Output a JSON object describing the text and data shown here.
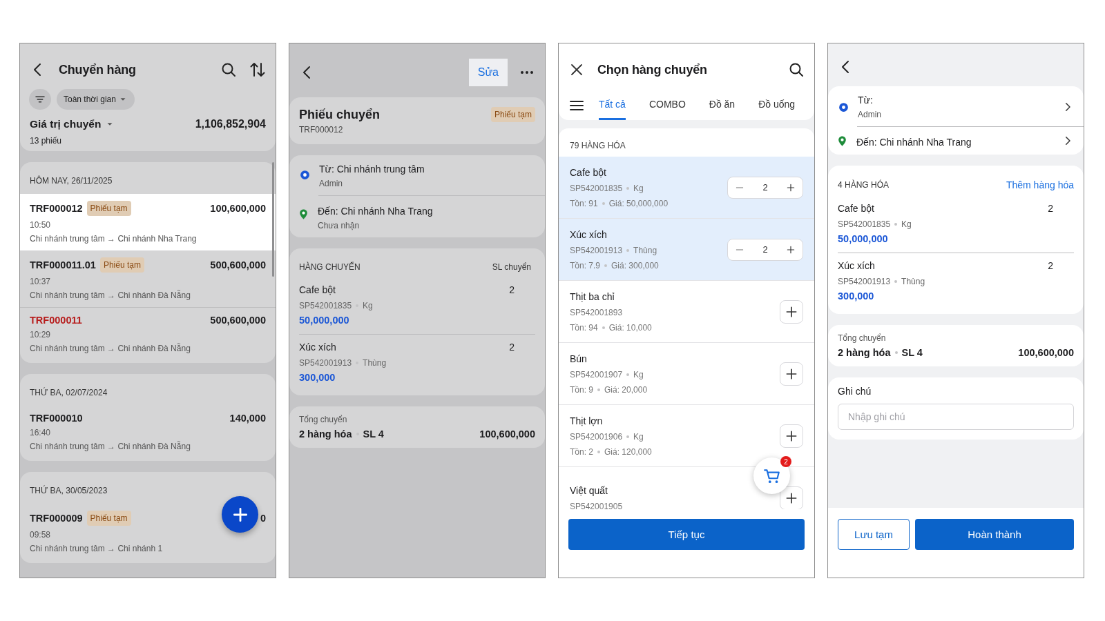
{
  "screens": [
    {
      "kind": "transfer_list",
      "dimmed": true,
      "title": "Chuyển hàng",
      "filter": {
        "label": "Toàn thời gian"
      },
      "summary": {
        "label": "Giá trị chuyển",
        "value": "1,106,852,904",
        "count": "13 phiếu"
      },
      "groups": [
        {
          "date": "HÔM NAY, 26/11/2025",
          "rows": [
            {
              "id": "TRF000012",
              "color": "#1c1c1e",
              "badge": "Phiếu tạm",
              "amount": "100,600,000",
              "time": "10:50",
              "route": "Chi nhánh trung tâm → Chi nhánh Nha Trang",
              "selected": true
            },
            {
              "id": "TRF000011.01",
              "color": "#1c1c1e",
              "badge": "Phiếu tạm",
              "amount": "500,600,000",
              "time": "10:37",
              "route": "Chi nhánh trung tâm → Chi nhánh Đà Nẵng",
              "selected": false
            },
            {
              "id": "TRF000011",
              "color": "#b71c1c",
              "amount": "500,600,000",
              "time": "10:29",
              "route": "Chi nhánh trung tâm → Chi nhánh Đà Nẵng",
              "selected": false
            }
          ]
        },
        {
          "date": "THỨ BA, 02/07/2024",
          "rows": [
            {
              "id": "TRF000010",
              "color": "#1c1c1e",
              "amount": "140,000",
              "time": "16:40",
              "route": "Chi nhánh trung tâm → Chi nhánh Đà Nẵng",
              "selected": false
            }
          ]
        },
        {
          "date": "THỨ BA, 30/05/2023",
          "rows": [
            {
              "id": "TRF000009",
              "color": "#1c1c1e",
              "badge": "Phiếu tạm",
              "amount": "0",
              "time": "09:58",
              "route": "Chi nhánh trung tâm → Chi nhánh 1",
              "selected": false
            }
          ]
        }
      ]
    },
    {
      "kind": "transfer_detail",
      "dimmed": true,
      "edit_button": {
        "label": "Sửa",
        "pressed": true
      },
      "title": "Phiếu chuyển",
      "code": "TRF000012",
      "badge": "Phiếu tạm",
      "from": {
        "label": "Từ: Chi nhánh trung tâm",
        "sub": "Admin"
      },
      "to": {
        "label": "Đến: Chi nhánh Nha Trang",
        "sub": "Chưa nhận"
      },
      "items_header": "HÀNG CHUYỂN",
      "qty_header": "SL chuyển",
      "items": [
        {
          "name": "Cafe bột",
          "code": "SP542001835",
          "unit": "Kg",
          "price": "50,000,000",
          "qty": "2"
        },
        {
          "name": "Xúc xích",
          "code": "SP542001913",
          "unit": "Thùng",
          "price": "300,000",
          "qty": "2"
        }
      ],
      "total": {
        "label": "Tổng chuyển",
        "items": "2 hàng hóa",
        "qty": "SL 4",
        "amount": "100,600,000"
      }
    },
    {
      "kind": "product_picker",
      "dimmed": false,
      "title": "Chọn hàng chuyển",
      "tabs": [
        {
          "label": "Tất cả",
          "selected": true
        },
        {
          "label": "COMBO",
          "selected": false
        },
        {
          "label": "Đồ ăn",
          "selected": false
        },
        {
          "label": "Đồ uống",
          "selected": false
        }
      ],
      "count": "79 HÀNG HÓA",
      "products": [
        {
          "name": "Cafe bột",
          "code": "SP542001835",
          "unit": "Kg",
          "stock": "Tồn: 91",
          "price": "Giá: 50,000,000",
          "selected": true,
          "qty": "2"
        },
        {
          "name": "Xúc xích",
          "code": "SP542001913",
          "unit": "Thùng",
          "stock": "Tồn: 7.9",
          "price": "Giá: 300,000",
          "selected": true,
          "qty": "2"
        },
        {
          "name": "Thịt ba chỉ",
          "code": "SP542001893",
          "stock": "Tồn: 94",
          "price": "Giá: 10,000",
          "selected": false
        },
        {
          "name": "Bún",
          "code": "SP542001907",
          "unit": "Kg",
          "stock": "Tồn: 9",
          "price": "Giá: 20,000",
          "selected": false
        },
        {
          "name": "Thịt lợn",
          "code": "SP542001906",
          "unit": "Kg",
          "stock": "Tồn: 2",
          "price": "Giá: 120,000",
          "selected": false
        },
        {
          "name": "Việt quất",
          "code": "SP542001905",
          "selected": false
        }
      ],
      "cart_badge": "2",
      "continue_button": "Tiếp tục"
    },
    {
      "kind": "transfer_form",
      "dimmed": false,
      "from": {
        "label": "Từ:",
        "sub": "Admin"
      },
      "to": {
        "label": "Đến: Chi nhánh Nha Trang"
      },
      "count": "4 HÀNG HÓA",
      "add_link": "Thêm hàng hóa",
      "items": [
        {
          "name": "Cafe bột",
          "code": "SP542001835",
          "unit": "Kg",
          "price": "50,000,000",
          "qty": "2"
        },
        {
          "name": "Xúc xích",
          "code": "SP542001913",
          "unit": "Thùng",
          "price": "300,000",
          "qty": "2"
        }
      ],
      "total": {
        "label": "Tổng chuyển",
        "items": "2 hàng hóa",
        "qty": "SL 4",
        "amount": "100,600,000"
      },
      "note": {
        "label": "Ghi chú",
        "placeholder": "Nhập ghi chú"
      },
      "buttons": [
        {
          "label": "Lưu tạm",
          "kind": "secondary"
        },
        {
          "label": "Hoàn thành",
          "kind": "primary"
        }
      ]
    }
  ]
}
